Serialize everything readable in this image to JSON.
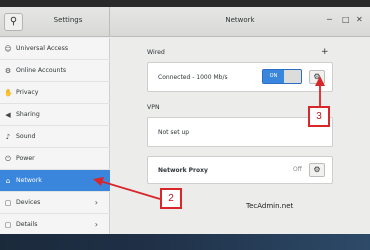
{
  "titles": {
    "settings": "Settings",
    "network": "Network"
  },
  "sidebar": {
    "items": [
      {
        "label": "Universal Access",
        "icon": "universal-access-icon",
        "glyph": "☺"
      },
      {
        "label": "Online Accounts",
        "icon": "online-accounts-icon",
        "glyph": "⚙"
      },
      {
        "label": "Privacy",
        "icon": "privacy-icon",
        "glyph": "✋"
      },
      {
        "label": "Sharing",
        "icon": "sharing-icon",
        "glyph": "◀"
      },
      {
        "label": "Sound",
        "icon": "sound-icon",
        "glyph": "♪"
      },
      {
        "label": "Power",
        "icon": "power-icon",
        "glyph": "⏻"
      },
      {
        "label": "Network",
        "icon": "network-icon",
        "glyph": "⌂"
      },
      {
        "label": "Devices",
        "icon": "devices-icon",
        "glyph": "▢",
        "chevron": "›"
      },
      {
        "label": "Details",
        "icon": "details-icon",
        "glyph": "▢",
        "chevron": "›"
      }
    ]
  },
  "wired": {
    "label": "Wired",
    "status": "Connected - 1000 Mb/s",
    "toggle_on": "ON",
    "add": "+"
  },
  "vpn": {
    "label": "VPN",
    "status": "Not set up"
  },
  "proxy": {
    "label": "Network Proxy",
    "status": "Off"
  },
  "watermark": "TecAdmin.net",
  "annotations": {
    "badge2": "2",
    "badge3": "3"
  },
  "colors": {
    "accent": "#3a86dc",
    "annotation": "#d9262a"
  }
}
